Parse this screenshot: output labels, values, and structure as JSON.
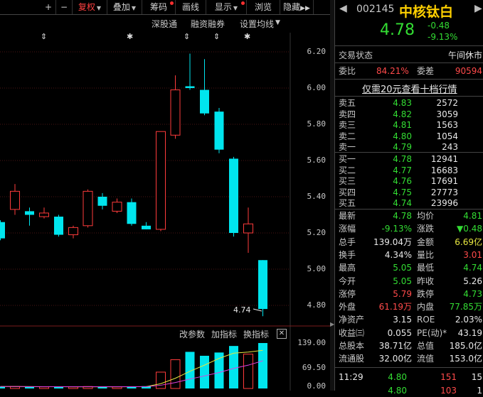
{
  "toolbar": {
    "plus": "+",
    "minus": "−",
    "fuquan": "复权",
    "diejia": "叠加",
    "chouma": "筹码",
    "huaxian": "画线",
    "xianshi": "显示",
    "liuyue": "浏览",
    "yincang": "隐藏"
  },
  "chart": {
    "links": [
      "深股通",
      "融资融券",
      "设置均线"
    ],
    "yticks": [
      "6.20",
      "6.00",
      "5.80",
      "5.60",
      "5.40",
      "5.20",
      "5.00",
      "4.80"
    ],
    "low_label": "4.74",
    "sub_links": [
      "改参数",
      "加指标",
      "换指标"
    ],
    "vol_ticks": [
      "139.00",
      "69.50",
      "0.00"
    ],
    "candles": [
      {
        "o": 5.26,
        "c": 5.17,
        "h": 5.27,
        "l": 5.16
      },
      {
        "o": 5.33,
        "c": 5.43,
        "h": 5.47,
        "l": 5.3
      },
      {
        "o": 5.32,
        "c": 5.3,
        "h": 5.34,
        "l": 5.24
      },
      {
        "o": 5.29,
        "c": 5.31,
        "h": 5.34,
        "l": 5.28
      },
      {
        "o": 5.29,
        "c": 5.19,
        "h": 5.3,
        "l": 5.18
      },
      {
        "o": 5.19,
        "c": 5.23,
        "h": 5.24,
        "l": 5.17
      },
      {
        "o": 5.24,
        "c": 5.43,
        "h": 5.44,
        "l": 5.23
      },
      {
        "o": 5.4,
        "c": 5.35,
        "h": 5.42,
        "l": 5.33
      },
      {
        "o": 5.32,
        "c": 5.37,
        "h": 5.39,
        "l": 5.31
      },
      {
        "o": 5.37,
        "c": 5.25,
        "h": 5.39,
        "l": 5.24
      },
      {
        "o": 5.24,
        "c": 5.22,
        "h": 5.26,
        "l": 5.22
      },
      {
        "o": 5.22,
        "c": 5.76,
        "h": 5.76,
        "l": 5.21
      },
      {
        "o": 5.74,
        "c": 5.99,
        "h": 6.07,
        "l": 5.72
      },
      {
        "o": 6.01,
        "c": 6.0,
        "h": 6.19,
        "l": 5.99
      },
      {
        "o": 5.99,
        "c": 5.86,
        "h": 6.16,
        "l": 5.85
      },
      {
        "o": 5.87,
        "c": 5.66,
        "h": 5.89,
        "l": 5.64
      },
      {
        "o": 5.61,
        "c": 5.2,
        "h": 5.62,
        "l": 5.18
      },
      {
        "o": 5.2,
        "c": 5.25,
        "h": 5.34,
        "l": 5.09
      },
      {
        "o": 5.05,
        "c": 4.78,
        "h": 5.05,
        "l": 4.74
      }
    ],
    "volumes": [
      6,
      6,
      5,
      5,
      5,
      5,
      6,
      5,
      5,
      6,
      7,
      50,
      88,
      112,
      100,
      110,
      130,
      105,
      139
    ]
  },
  "panel": {
    "code": "002145",
    "name": "中核钛白",
    "price": "4.78",
    "change": "-0.48",
    "change_pct": "-9.13%",
    "status_label": "交易状态",
    "status_value": "午间休市",
    "weibi_label": "委比",
    "weibi_value": "84.21%",
    "weicha_label": "委差",
    "weicha_value": "90594",
    "promo": "仅需20元查看十档行情",
    "asks": [
      {
        "label": "卖五",
        "price": "4.83",
        "vol": "2572"
      },
      {
        "label": "卖四",
        "price": "4.82",
        "vol": "3059"
      },
      {
        "label": "卖三",
        "price": "4.81",
        "vol": "1563"
      },
      {
        "label": "卖二",
        "price": "4.80",
        "vol": "1054"
      },
      {
        "label": "卖一",
        "price": "4.79",
        "vol": "243"
      }
    ],
    "bids": [
      {
        "label": "买一",
        "price": "4.78",
        "vol": "12941"
      },
      {
        "label": "买二",
        "price": "4.77",
        "vol": "16683"
      },
      {
        "label": "买三",
        "price": "4.76",
        "vol": "17691"
      },
      {
        "label": "买四",
        "price": "4.75",
        "vol": "27773"
      },
      {
        "label": "买五",
        "price": "4.74",
        "vol": "23996"
      }
    ],
    "stats": [
      {
        "l1": "最新",
        "v1": "4.78",
        "c1": "green",
        "l2": "均价",
        "v2": "4.81",
        "c2": "green"
      },
      {
        "l1": "涨幅",
        "v1": "-9.13%",
        "c1": "green",
        "l2": "涨跌",
        "v2": "▼0.48",
        "c2": "green"
      },
      {
        "l1": "总手",
        "v1": "139.04万",
        "c1": "white",
        "l2": "金额",
        "v2": "6.69亿",
        "c2": "yellow"
      },
      {
        "l1": "换手",
        "v1": "4.34%",
        "c1": "white",
        "l2": "量比",
        "v2": "3.01",
        "c2": "red2"
      },
      {
        "l1": "最高",
        "v1": "5.05",
        "c1": "green",
        "l2": "最低",
        "v2": "4.74",
        "c2": "green"
      },
      {
        "l1": "今开",
        "v1": "5.05",
        "c1": "green",
        "l2": "昨收",
        "v2": "5.26",
        "c2": "white"
      },
      {
        "l1": "涨停",
        "v1": "5.79",
        "c1": "red2",
        "l2": "跌停",
        "v2": "4.73",
        "c2": "green"
      },
      {
        "l1": "外盘",
        "v1": "61.19万",
        "c1": "red2",
        "l2": "内盘",
        "v2": "77.85万",
        "c2": "green"
      },
      {
        "l1": "净资产",
        "v1": "3.15",
        "c1": "white",
        "l2": "ROE",
        "v2": "2.03%",
        "c2": "white"
      },
      {
        "l1": "收益㈢",
        "v1": "0.055",
        "c1": "white",
        "l2": "PE(动)*",
        "v2": "43.19",
        "c2": "white"
      },
      {
        "l1": "总股本",
        "v1": "38.71亿",
        "c1": "white",
        "l2": "总值",
        "v2": "185.0亿",
        "c2": "white"
      },
      {
        "l1": "流通股",
        "v1": "32.00亿",
        "c1": "white",
        "l2": "流值",
        "v2": "153.0亿",
        "c2": "white"
      }
    ],
    "ticks": [
      {
        "time": "11:29",
        "price": "4.80",
        "vol": "151",
        "extra": "15"
      },
      {
        "time": "",
        "price": "4.80",
        "vol": "103",
        "extra": "1"
      }
    ],
    "colors": {
      "up": "#ff4a4a",
      "down": "#33dd33",
      "bear_candle": "#00e5ee",
      "bull_candle": "#ff3b3b"
    }
  }
}
